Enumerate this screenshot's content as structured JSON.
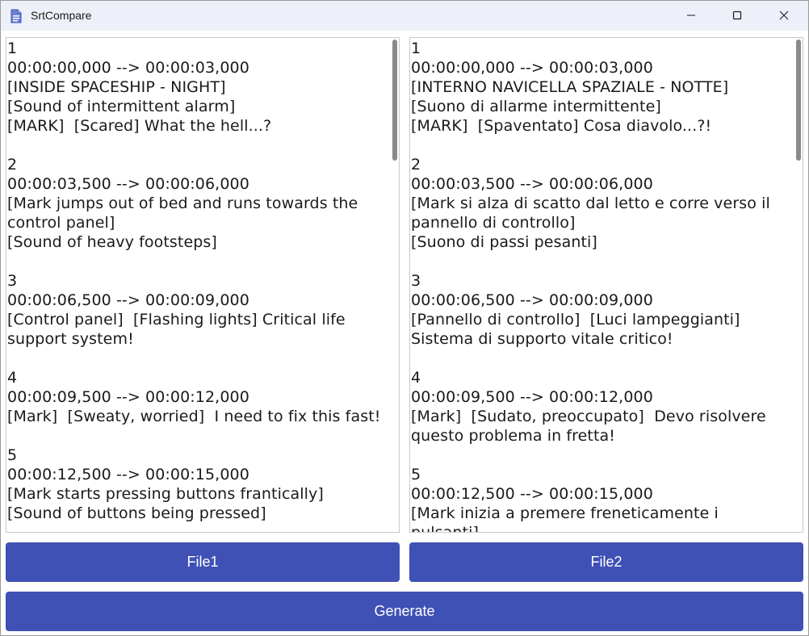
{
  "window": {
    "title": "SrtCompare"
  },
  "left_panel": {
    "text": "1\n00:00:00,000 --> 00:00:03,000\n[INSIDE SPACESHIP - NIGHT]\n[Sound of intermittent alarm]\n[MARK]  [Scared] What the hell...?\n\n2\n00:00:03,500 --> 00:00:06,000\n[Mark jumps out of bed and runs towards the control panel]\n[Sound of heavy footsteps]\n\n3\n00:00:06,500 --> 00:00:09,000\n[Control panel]  [Flashing lights] Critical life support system!\n\n4\n00:00:09,500 --> 00:00:12,000\n[Mark]  [Sweaty, worried]  I need to fix this fast!\n\n5\n00:00:12,500 --> 00:00:15,000\n[Mark starts pressing buttons frantically]\n[Sound of buttons being pressed]"
  },
  "right_panel": {
    "text": "1\n00:00:00,000 --> 00:00:03,000\n[INTERNO NAVICELLA SPAZIALE - NOTTE]\n[Suono di allarme intermittente]\n[MARK]  [Spaventato] Cosa diavolo...?!\n\n2\n00:00:03,500 --> 00:00:06,000\n[Mark si alza di scatto dal letto e corre verso il pannello di controllo]\n[Suono di passi pesanti]\n\n3\n00:00:06,500 --> 00:00:09,000\n[Pannello di controllo]  [Luci lampeggianti] Sistema di supporto vitale critico!\n\n4\n00:00:09,500 --> 00:00:12,000\n[Mark]  [Sudato, preoccupato]  Devo risolvere questo problema in fretta!\n\n5\n00:00:12,500 --> 00:00:15,000\n[Mark inizia a premere freneticamente i pulsanti]"
  },
  "buttons": {
    "file1": "File1",
    "file2": "File2",
    "generate": "Generate"
  },
  "colors": {
    "accent": "#3f51b5",
    "titlebar": "#eef0f9"
  },
  "icons": {
    "app": "document-icon",
    "minimize": "minimize-icon",
    "maximize": "maximize-icon",
    "close": "close-icon"
  }
}
